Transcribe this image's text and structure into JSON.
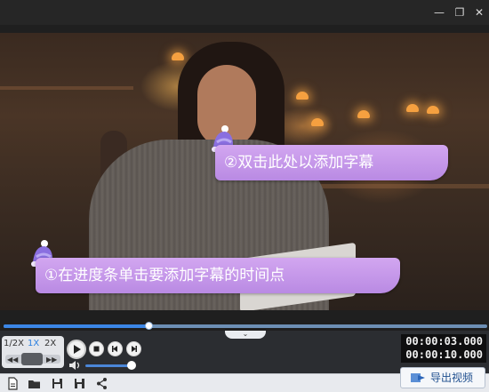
{
  "titlebar": {
    "minimize_glyph": "—",
    "restore_glyph": "❐",
    "close_glyph": "✕"
  },
  "hints": {
    "step2": "②双击此处以添加字幕",
    "step1": "①在进度条单击要添加字幕的时间点"
  },
  "progress": {
    "played_fraction": 0.3
  },
  "speed": {
    "options": [
      "1/2X",
      "1X",
      "2X"
    ],
    "selected": "1X"
  },
  "volume": {
    "level": 0.88
  },
  "time": {
    "current": "00:00:03.000",
    "total": "00:00:10.000"
  },
  "toolbar": {
    "icons": [
      "new-file-icon",
      "open-folder-icon",
      "save-icon",
      "save-as-icon",
      "share-icon"
    ],
    "export_label": "导出视频"
  },
  "colors": {
    "accent": "#3b86e6",
    "hint_bg": "#c79bec"
  }
}
